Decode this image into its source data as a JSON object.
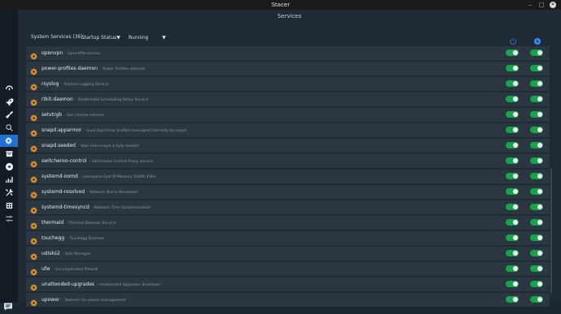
{
  "window": {
    "title": "Stacer"
  },
  "page": {
    "title": "Services"
  },
  "toolbar": {
    "label": "System Services (36)",
    "startup_filter": "Startup Status",
    "running_filter": "Running",
    "power_icon": "power-icon",
    "refresh_icon": "refresh-icon"
  },
  "colors": {
    "accent": "#1f6fd6",
    "toggle_on": "#17a34a",
    "gear": "#f0941f"
  },
  "sidebar": {
    "items": [
      {
        "icon": "dashboard-icon"
      },
      {
        "icon": "rocket-icon"
      },
      {
        "icon": "broom-icon"
      },
      {
        "icon": "search-icon"
      },
      {
        "icon": "gears-icon",
        "active": true
      },
      {
        "icon": "package-icon"
      },
      {
        "icon": "disk-icon"
      },
      {
        "icon": "chart-icon"
      },
      {
        "icon": "tools-icon"
      },
      {
        "icon": "apt-icon"
      },
      {
        "icon": "sliders-icon"
      }
    ],
    "feedback_icon": "chat-icon"
  },
  "services": [
    {
      "name": "openvpn",
      "desc": "- OpenVPN service",
      "startup": true,
      "running": true
    },
    {
      "name": "power-profiles-daemon",
      "desc": "- Power Profiles daemon",
      "startup": true,
      "running": true
    },
    {
      "name": "rsyslog",
      "desc": "- System Logging Service",
      "startup": true,
      "running": true
    },
    {
      "name": "rtkit-daemon",
      "desc": "- RealtimeKit Scheduling Policy Service",
      "startup": true,
      "running": true
    },
    {
      "name": "setvtrgb",
      "desc": "- Set console scheme",
      "startup": true,
      "running": true
    },
    {
      "name": "snapd.apparmor",
      "desc": "- Load AppArmor profiles managed internally by snapd",
      "startup": true,
      "running": true
    },
    {
      "name": "snapd.seeded",
      "desc": "- Wait until snapd is fully seeded",
      "startup": true,
      "running": true
    },
    {
      "name": "switcheroo-control",
      "desc": "- Switcheroo Control Proxy service",
      "startup": true,
      "running": true
    },
    {
      "name": "systemd-oomd",
      "desc": "- Userspace Out-Of-Memory (OOM) Killer",
      "startup": true,
      "running": true
    },
    {
      "name": "systemd-resolved",
      "desc": "- Network Name Resolution",
      "startup": true,
      "running": true
    },
    {
      "name": "systemd-timesyncd",
      "desc": "- Network Time Synchronization",
      "startup": true,
      "running": true
    },
    {
      "name": "thermald",
      "desc": "- Thermal Daemon Service",
      "startup": true,
      "running": true
    },
    {
      "name": "touchegg",
      "desc": "- Touchégg Daemon",
      "startup": true,
      "running": true
    },
    {
      "name": "udisks2",
      "desc": "- Disk Manager",
      "startup": true,
      "running": true
    },
    {
      "name": "ufw",
      "desc": "- Uncomplicated firewall",
      "startup": true,
      "running": true
    },
    {
      "name": "unattended-upgrades",
      "desc": "- Unattended Upgrades Shutdown",
      "startup": true,
      "running": true
    },
    {
      "name": "upower",
      "desc": "- Daemon for power management",
      "startup": true,
      "running": true
    }
  ]
}
